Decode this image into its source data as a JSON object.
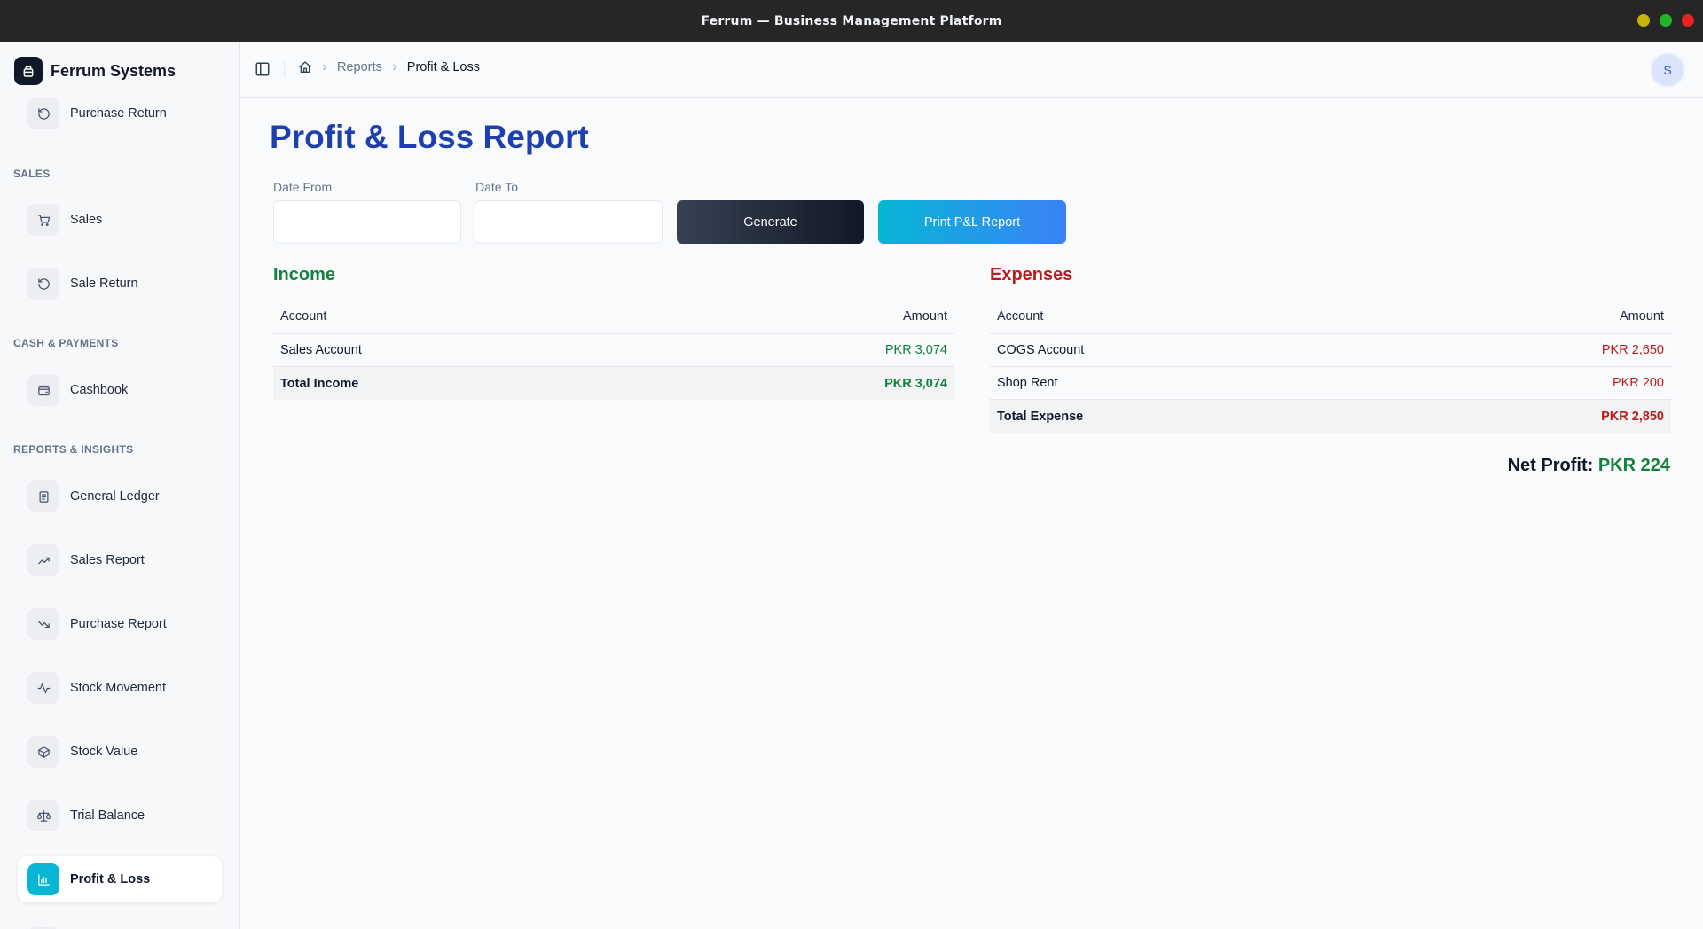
{
  "window": {
    "title": "Ferrum — Business Management Platform",
    "controls": {
      "minimize_color": "#c8b400",
      "maximize_color": "#22b52b",
      "close_color": "#e52424"
    }
  },
  "sidebar": {
    "brand": "Ferrum Systems",
    "items_top": [
      {
        "label": "Purchase Return",
        "icon": "rotate-ccw-icon"
      }
    ],
    "sections": [
      {
        "title": "SALES",
        "items": [
          {
            "label": "Sales",
            "icon": "cart-icon"
          },
          {
            "label": "Sale Return",
            "icon": "rotate-ccw-icon"
          }
        ]
      },
      {
        "title": "CASH & PAYMENTS",
        "items": [
          {
            "label": "Cashbook",
            "icon": "wallet-icon"
          }
        ]
      },
      {
        "title": "REPORTS & INSIGHTS",
        "items": [
          {
            "label": "General Ledger",
            "icon": "ledger-icon"
          },
          {
            "label": "Sales Report",
            "icon": "trending-up-icon"
          },
          {
            "label": "Purchase Report",
            "icon": "trending-down-icon"
          },
          {
            "label": "Stock Movement",
            "icon": "activity-icon"
          },
          {
            "label": "Stock Value",
            "icon": "box-icon"
          },
          {
            "label": "Trial Balance",
            "icon": "scale-icon"
          },
          {
            "label": "Profit & Loss",
            "icon": "bar-chart-icon",
            "active": true
          }
        ]
      }
    ]
  },
  "header": {
    "breadcrumb": [
      "Reports",
      "Profit & Loss"
    ],
    "avatar_initial": "S"
  },
  "page": {
    "title": "Profit & Loss Report",
    "filters": {
      "date_from_label": "Date From",
      "date_from_value": "",
      "date_to_label": "Date To",
      "date_to_value": ""
    },
    "buttons": {
      "generate": "Generate",
      "print": "Print P&L Report"
    }
  },
  "income": {
    "title": "Income",
    "columns": [
      "Account",
      "Amount"
    ],
    "rows": [
      {
        "account": "Sales Account",
        "amount": "PKR 3,074"
      }
    ],
    "total": {
      "label": "Total Income",
      "amount": "PKR 3,074"
    }
  },
  "expenses": {
    "title": "Expenses",
    "columns": [
      "Account",
      "Amount"
    ],
    "rows": [
      {
        "account": "COGS Account",
        "amount": "PKR 2,650"
      },
      {
        "account": "Shop Rent",
        "amount": "PKR 200"
      }
    ],
    "total": {
      "label": "Total Expense",
      "amount": "PKR 2,850"
    }
  },
  "net_profit": {
    "label": "Net Profit:",
    "value": "PKR 224"
  },
  "colors": {
    "title_blue": "#1e40af",
    "income_green": "#15803d",
    "expense_red": "#b91c1c",
    "active_cyan": "#06b6d4"
  }
}
